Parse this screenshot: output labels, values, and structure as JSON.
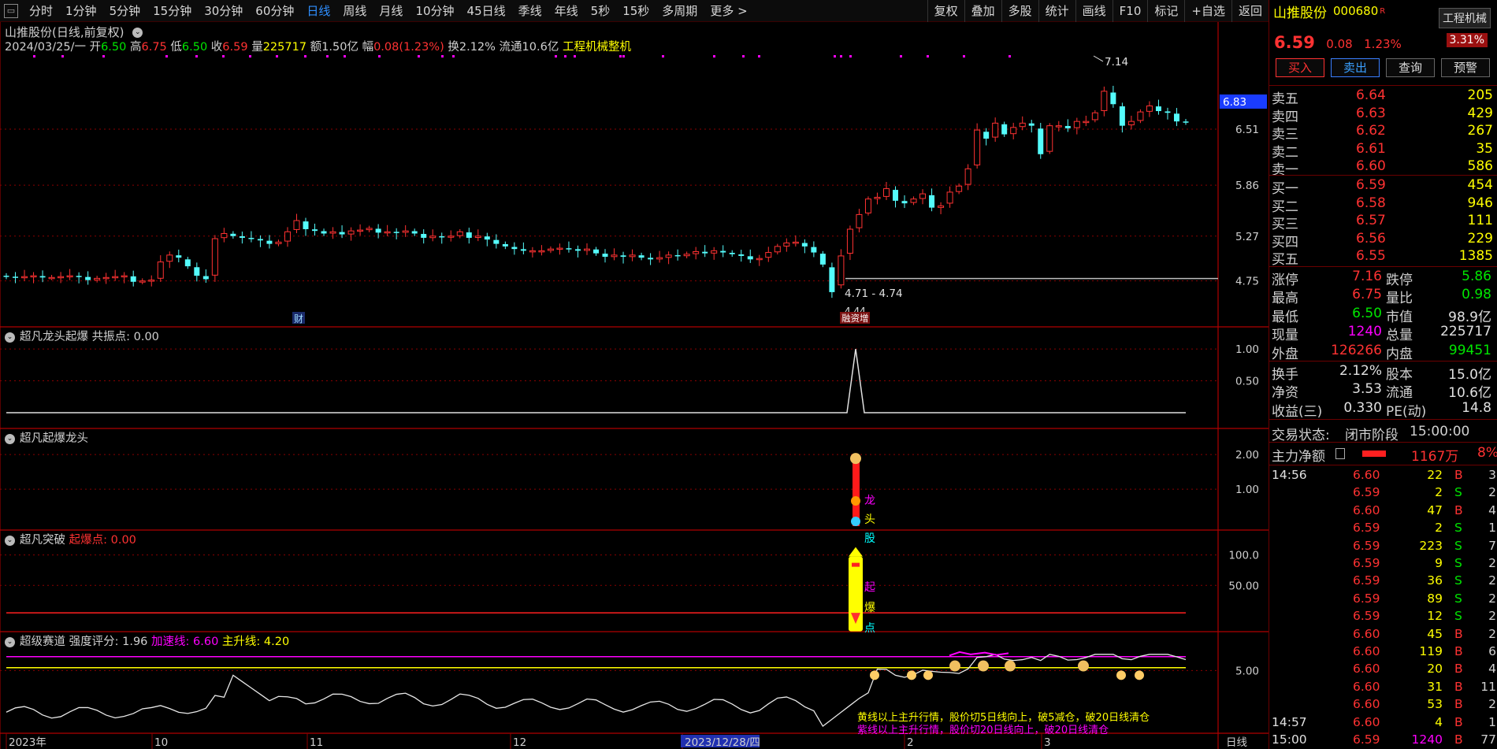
{
  "toolbar": {
    "periods": [
      "分时",
      "1分钟",
      "5分钟",
      "15分钟",
      "30分钟",
      "60分钟",
      "日线",
      "周线",
      "月线",
      "10分钟",
      "45日线",
      "季线",
      "年线",
      "5秒",
      "15秒",
      "多周期",
      "更多 >"
    ],
    "active": "日线",
    "tools": [
      "复权",
      "叠加",
      "多股",
      "统计",
      "画线",
      "F10",
      "标记",
      "+自选",
      "返回"
    ]
  },
  "chart_header": {
    "title": "山推股份(日线,前复权)",
    "date": "2024/03/25/一",
    "open_label": "开",
    "open": "6.50",
    "high_label": "高",
    "high": "6.75",
    "low_label": "低",
    "low": "6.50",
    "close_label": "收",
    "close": "6.59",
    "vol_label": "量",
    "vol": "225717",
    "amount_label": "额",
    "amount": "1.50亿",
    "chg_label": "幅",
    "chg": "0.08(1.23%)",
    "turnover_label": "换",
    "turnover": "2.12%",
    "float_label": "流通",
    "float": "10.6亿",
    "industry": "工程机械整机"
  },
  "main_axis": {
    "ticks": [
      "6.51",
      "5.86",
      "5.27",
      "4.75"
    ],
    "current": "6.83"
  },
  "annotations": {
    "high_price": "7.14",
    "low_range": "4.71 - 4.74",
    "low_price": "4.44",
    "finance_tag": "财",
    "event_tag": "融资增"
  },
  "panels": {
    "p1": {
      "title": "超凡龙头起爆",
      "label": "共振点:",
      "value": "0.00",
      "ticks": [
        "1.00",
        "0.50"
      ]
    },
    "p2": {
      "title": "超凡起爆龙头",
      "ticks": [
        "2.00",
        "1.00"
      ],
      "chars": [
        "龙",
        "头",
        "股"
      ]
    },
    "p3": {
      "title": "超凡突破",
      "label": "起爆点:",
      "value": "0.00",
      "ticks": [
        "100.0",
        "50.00"
      ],
      "chars": [
        "起",
        "爆",
        "点"
      ]
    },
    "p4": {
      "title": "超级赛道",
      "label1": "强度评分:",
      "value1": "1.96",
      "label2": "加速线:",
      "value2": "6.60",
      "label3": "主升线:",
      "value3": "4.20",
      "tick": "5.00",
      "note1": "黄线以上主升行情，股价切5日线向上，破5减仓，破20日线清仓",
      "note2": "紫线以上主升行情，股价切20日线向上，破20日线清仓"
    }
  },
  "date_axis": {
    "labels": [
      "2023年",
      "10",
      "11",
      "12",
      "2023/12/28/四",
      "2",
      "3"
    ],
    "period": "日线"
  },
  "quote": {
    "name": "山推股份",
    "code": "000680",
    "r_mark": "R",
    "industry": "工程机械",
    "pct_tag": "3.31%",
    "price": "6.59",
    "chg": "0.08",
    "chg_pct": "1.23%",
    "actions": [
      "买入",
      "卖出",
      "查询",
      "预警"
    ],
    "asks": [
      {
        "name": "卖五",
        "price": "6.64",
        "vol": "205"
      },
      {
        "name": "卖四",
        "price": "6.63",
        "vol": "429"
      },
      {
        "name": "卖三",
        "price": "6.62",
        "vol": "267"
      },
      {
        "name": "卖二",
        "price": "6.61",
        "vol": "35"
      },
      {
        "name": "卖一",
        "price": "6.60",
        "vol": "586"
      }
    ],
    "bids": [
      {
        "name": "买一",
        "price": "6.59",
        "vol": "454"
      },
      {
        "name": "买二",
        "price": "6.58",
        "vol": "946"
      },
      {
        "name": "买三",
        "price": "6.57",
        "vol": "111"
      },
      {
        "name": "买四",
        "price": "6.56",
        "vol": "229"
      },
      {
        "name": "买五",
        "price": "6.55",
        "vol": "1385"
      }
    ],
    "stats": [
      [
        {
          "k": "涨停",
          "v": "7.16",
          "c": "red"
        },
        {
          "k": "跌停",
          "v": "5.86",
          "c": "green"
        }
      ],
      [
        {
          "k": "最高",
          "v": "6.75",
          "c": "red"
        },
        {
          "k": "量比",
          "v": "0.98",
          "c": "green"
        }
      ],
      [
        {
          "k": "最低",
          "v": "6.50",
          "c": "green"
        },
        {
          "k": "市值",
          "v": "98.9亿",
          "c": "white"
        }
      ],
      [
        {
          "k": "现量",
          "v": "1240",
          "c": "mag"
        },
        {
          "k": "总量",
          "v": "225717",
          "c": "white"
        }
      ],
      [
        {
          "k": "外盘",
          "v": "126266",
          "c": "red"
        },
        {
          "k": "内盘",
          "v": "99451",
          "c": "green"
        }
      ]
    ],
    "stats2": [
      [
        {
          "k": "换手",
          "v": "2.12%",
          "c": "white"
        },
        {
          "k": "股本",
          "v": "15.0亿",
          "c": "white"
        }
      ],
      [
        {
          "k": "净资",
          "v": "3.53",
          "c": "white"
        },
        {
          "k": "流通",
          "v": "10.6亿",
          "c": "white"
        }
      ],
      [
        {
          "k": "收益(三)",
          "v": "0.330",
          "c": "white"
        },
        {
          "k": "PE(动)",
          "v": "14.8",
          "c": "white"
        }
      ]
    ],
    "trade_status_label": "交易状态:",
    "trade_status": "闭市阶段",
    "trade_time": "15:00:00",
    "main_flow_label": "主力净额",
    "main_flow": "1167万",
    "main_flow_pct": "8%",
    "ticks": [
      {
        "t": "14:56",
        "p": "6.60",
        "v": "22",
        "d": "B",
        "n": "3"
      },
      {
        "t": "",
        "p": "6.59",
        "v": "2",
        "d": "S",
        "n": "2"
      },
      {
        "t": "",
        "p": "6.60",
        "v": "47",
        "d": "B",
        "n": "4"
      },
      {
        "t": "",
        "p": "6.59",
        "v": "2",
        "d": "S",
        "n": "1"
      },
      {
        "t": "",
        "p": "6.59",
        "v": "223",
        "d": "S",
        "n": "7"
      },
      {
        "t": "",
        "p": "6.59",
        "v": "9",
        "d": "S",
        "n": "2"
      },
      {
        "t": "",
        "p": "6.59",
        "v": "36",
        "d": "S",
        "n": "2"
      },
      {
        "t": "",
        "p": "6.59",
        "v": "89",
        "d": "S",
        "n": "2"
      },
      {
        "t": "",
        "p": "6.59",
        "v": "12",
        "d": "S",
        "n": "2"
      },
      {
        "t": "",
        "p": "6.60",
        "v": "45",
        "d": "B",
        "n": "2"
      },
      {
        "t": "",
        "p": "6.60",
        "v": "119",
        "d": "B",
        "n": "6"
      },
      {
        "t": "",
        "p": "6.60",
        "v": "20",
        "d": "B",
        "n": "4"
      },
      {
        "t": "",
        "p": "6.60",
        "v": "31",
        "d": "B",
        "n": "11"
      },
      {
        "t": "",
        "p": "6.60",
        "v": "53",
        "d": "B",
        "n": "2"
      },
      {
        "t": "14:57",
        "p": "6.60",
        "v": "4",
        "d": "B",
        "n": "1"
      },
      {
        "t": "15:00",
        "p": "6.59",
        "v": "1240",
        "d": "B",
        "n": "77"
      }
    ]
  },
  "colors": {
    "up": "#ff3232",
    "down": "#54fcfc",
    "bg": "#000000",
    "grid": "#8b0000",
    "yellow": "#ffff00",
    "magenta": "#ff00ff",
    "blue": "#2f8fff"
  },
  "chart_data": {
    "type": "candlestick",
    "closes": [
      4.8,
      4.79,
      4.8,
      4.81,
      4.79,
      4.79,
      4.8,
      4.81,
      4.8,
      4.76,
      4.78,
      4.79,
      4.8,
      4.81,
      4.74,
      4.75,
      4.76,
      4.97,
      5.05,
      5.02,
      4.92,
      4.81,
      4.77,
      5.24,
      5.3,
      5.27,
      5.25,
      5.24,
      5.22,
      5.18,
      5.2,
      5.32,
      5.45,
      5.35,
      5.33,
      5.3,
      5.32,
      5.29,
      5.33,
      5.34,
      5.36,
      5.31,
      5.32,
      5.31,
      5.33,
      5.3,
      5.25,
      5.27,
      5.26,
      5.27,
      5.32,
      5.25,
      5.27,
      5.23,
      5.18,
      5.15,
      5.12,
      5.1,
      5.1,
      5.1,
      5.12,
      5.13,
      5.12,
      5.1,
      5.12,
      5.07,
      5.03,
      5.05,
      5.03,
      5.05,
      5.02,
      5.0,
      5.02,
      5.05,
      5.04,
      5.06,
      5.09,
      5.07,
      5.1,
      5.08,
      5.06,
      5.04,
      5.0,
      5.01,
      5.08,
      5.15,
      5.19,
      5.2,
      5.15,
      5.08,
      4.94,
      4.62,
      5.04,
      5.35,
      5.52,
      5.7,
      5.72,
      5.82,
      5.68,
      5.65,
      5.7,
      5.76,
      5.6,
      5.62,
      5.78,
      5.85,
      6.05,
      6.5,
      6.4,
      6.58,
      6.45,
      6.53,
      6.58,
      6.55,
      6.22,
      6.55,
      6.55,
      6.52,
      6.6,
      6.6,
      6.7,
      6.95,
      6.8,
      6.55,
      6.6,
      6.71,
      6.78,
      6.72,
      6.7,
      6.6,
      6.59
    ]
  }
}
